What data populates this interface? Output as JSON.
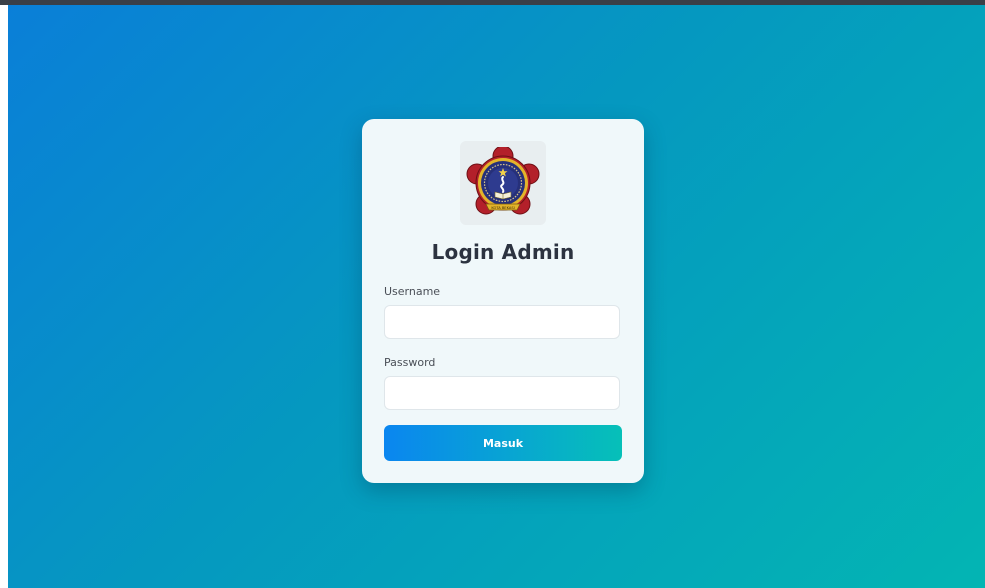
{
  "login": {
    "title": "Login Admin",
    "username_label": "Username",
    "username_value": "",
    "username_placeholder": "",
    "password_label": "Password",
    "password_value": "",
    "password_placeholder": "",
    "submit_label": "Masuk",
    "logo_icon": "university-seal-emblem",
    "logo_banner_text": "KOTA BEKASI"
  },
  "colors": {
    "background_start": "#0a7fd8",
    "background_end": "#03b5b3",
    "card_background": "#f0f8fa",
    "button_start": "#0a86f0",
    "button_end": "#06c0b8",
    "title_color": "#2c3340"
  }
}
